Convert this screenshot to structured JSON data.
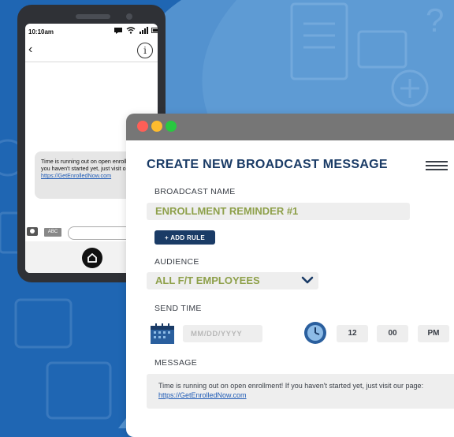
{
  "phone": {
    "status_time": "10:10am",
    "back_icon": "chevron-left-icon",
    "info_icon": "info-icon",
    "sms_text": "Time is running out on open enrollment! If you haven't started yet, just visit our page:",
    "sms_link": "https://GetEnrolledNow.com",
    "abc_label": "ABC",
    "home_icon": "home-icon"
  },
  "window": {
    "title": "CREATE NEW BROADCAST MESSAGE",
    "broadcast_name_label": "BROADCAST NAME",
    "broadcast_name_value": "ENROLLMENT REMINDER #1",
    "add_rule_label": "+ ADD RULE",
    "audience_label": "AUDIENCE",
    "audience_value": "ALL F/T EMPLOYEES",
    "send_time_label": "SEND TIME",
    "date_placeholder": "MM/DD/YYYY",
    "hour": "12",
    "minute": "00",
    "ampm": "PM",
    "message_label": "MESSAGE",
    "message_text": "Time is running out on open enrollment! If you haven't started yet, just visit our page:",
    "message_link": "https://GetEnrolledNow.com"
  },
  "colors": {
    "background": "#1f66b3",
    "title_navy": "#1a3b66",
    "value_green": "#8ea04a",
    "field_gray": "#eeeeee",
    "titlebar_gray": "#767676"
  }
}
